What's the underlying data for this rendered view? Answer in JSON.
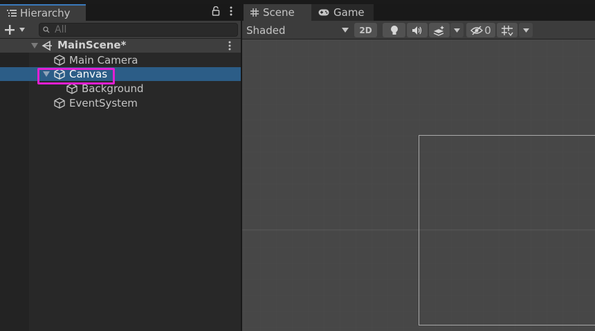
{
  "hierarchy": {
    "tab_title": "Hierarchy",
    "search_placeholder": "All",
    "scene_name": "MainScene*",
    "items": [
      {
        "label": "Main Camera",
        "icon": "gameobject-icon"
      },
      {
        "label": "Canvas",
        "icon": "gameobject-icon",
        "selected": true
      },
      {
        "label": "Background",
        "icon": "gameobject-icon"
      },
      {
        "label": "EventSystem",
        "icon": "gameobject-icon"
      }
    ]
  },
  "scene_view": {
    "tabs": [
      {
        "label": "Scene",
        "icon": "hash-icon",
        "active": true
      },
      {
        "label": "Game",
        "icon": "gamepad-icon",
        "active": false
      }
    ],
    "draw_mode": "Shaded",
    "mode_2d": "2D",
    "hidden_count": "0"
  },
  "colors": {
    "selection": "#2c5d87",
    "highlight": "#e21fd3",
    "tab_accent": "#3a79bb"
  }
}
